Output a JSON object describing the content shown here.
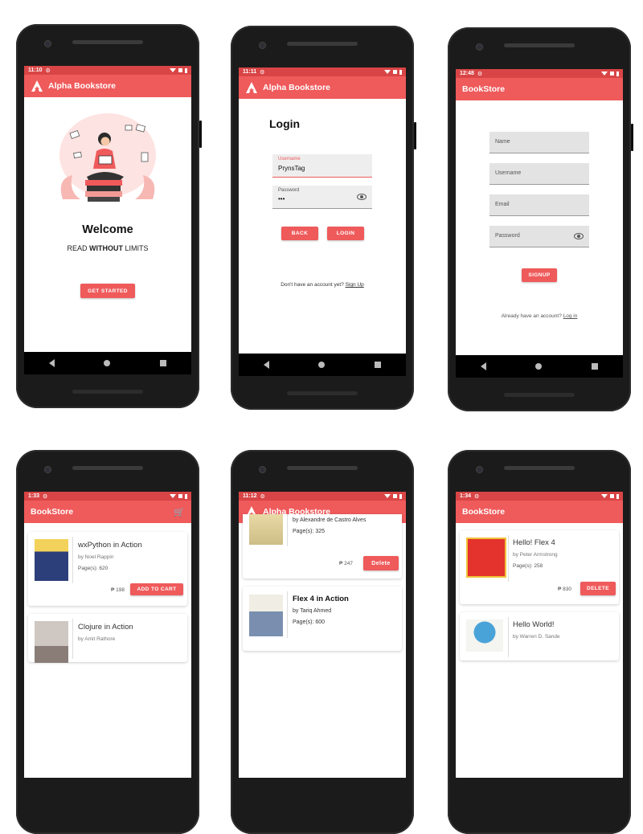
{
  "colors": {
    "accent": "#ef5a5b",
    "status_bar": "#d94546"
  },
  "welcome": {
    "status_time": "11:10",
    "app_title": "Alpha Bookstore",
    "heading": "Welcome",
    "tagline_pre": "READ ",
    "tagline_bold": "WITHOUT",
    "tagline_post": " LIMITS",
    "cta": "GET STARTED"
  },
  "login": {
    "status_time": "11:11",
    "app_title": "Alpha Bookstore",
    "heading": "Login",
    "username_label": "Username",
    "username_value": "PrynsTag",
    "password_label": "Password",
    "password_value": "•••",
    "back_button": "BACK",
    "login_button": "LOGIN",
    "footer_text": "Don't have an account yet? ",
    "footer_link": "Sign Up"
  },
  "signup": {
    "status_time": "12:48",
    "app_title": "BookStore",
    "name_placeholder": "Name",
    "username_placeholder": "Username",
    "email_placeholder": "Email",
    "password_placeholder": "Password",
    "signup_button": "SIGNUP",
    "footer_text": "Already have an account? ",
    "footer_link": "Log in"
  },
  "store": {
    "status_time": "1:33",
    "app_title": "BookStore",
    "books": [
      {
        "title": "wxPython in Action",
        "author": "by Noel Rappin",
        "pages": "Page(s): 620",
        "price": "₱ 198",
        "action": "ADD TO CART"
      },
      {
        "title": "Clojure in Action",
        "author": "by Amit Rathore"
      }
    ]
  },
  "admin": {
    "status_time": "11:12",
    "app_title": "Alpha Bookstore",
    "books": [
      {
        "author": "by Alexandre de Castro Alves",
        "pages": "Page(s): 325",
        "price": "₱ 247",
        "action": "Delete"
      },
      {
        "title": "Flex 4 in Action",
        "author": "by Tariq Ahmed",
        "pages": "Page(s): 600"
      }
    ]
  },
  "admin2": {
    "status_time": "1:34",
    "app_title": "BookStore",
    "books": [
      {
        "title": "Hello! Flex 4",
        "author": "by Peter Armstrong",
        "pages": "Page(s): 258",
        "price": "₱ 830",
        "action": "DELETE"
      },
      {
        "title": "Hello World!",
        "author": "by Warren D. Sande"
      }
    ]
  }
}
